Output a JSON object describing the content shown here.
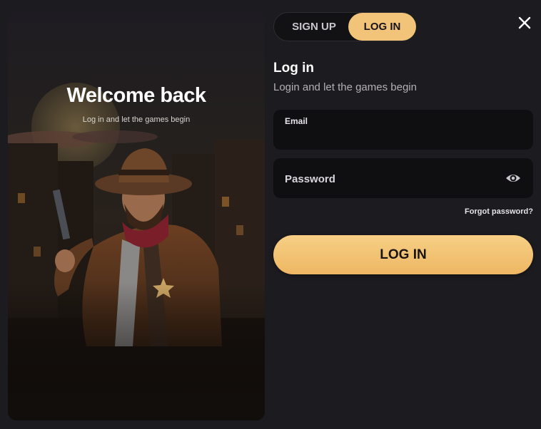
{
  "hero": {
    "title": "Welcome back",
    "subtitle": "Log in and let the games begin",
    "illustration": "cowboy-sheriff-illustration"
  },
  "tabs": [
    {
      "label": "SIGN UP",
      "active": false
    },
    {
      "label": "LOG IN",
      "active": true
    }
  ],
  "close_icon": "close-icon",
  "form": {
    "title": "Log in",
    "subtitle": "Login and let the games begin",
    "email": {
      "label": "Email",
      "value": ""
    },
    "password": {
      "placeholder": "Password",
      "icon": "eye-icon"
    },
    "forgot_label": "Forgot password?",
    "submit_label": "LOG IN"
  },
  "colors": {
    "background": "#1c1b1f",
    "accent": "#f2c479",
    "field": "#0f0e11"
  }
}
